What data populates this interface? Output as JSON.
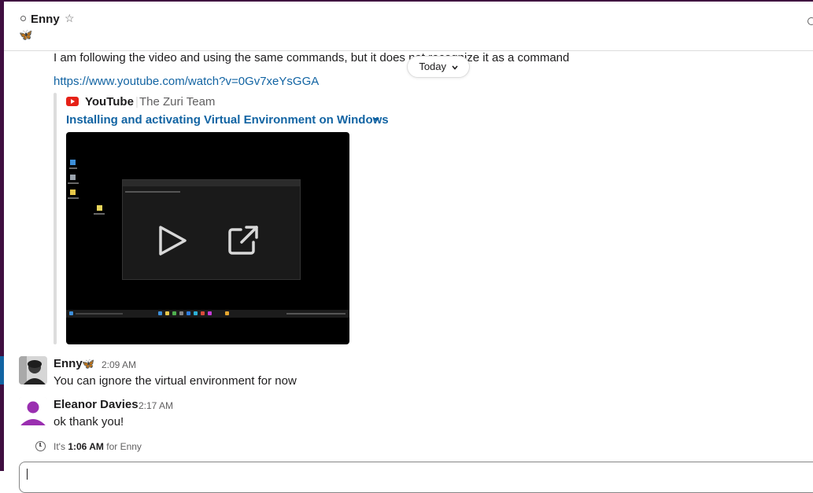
{
  "header": {
    "channel_name": "Enny",
    "status_emoji": "🦋",
    "star_icon": "☆"
  },
  "floating": {
    "today_label": "Today"
  },
  "message1": {
    "text": "I am following the video and using the same commands, but it does not recognize it as a command",
    "link": "https://www.youtube.com/watch?v=0Gv7xeYsGGA",
    "unfurl": {
      "service": "YouTube",
      "author": "The Zuri Team",
      "title": "Installing and activating Virtual Environment on Windows"
    }
  },
  "messages": [
    {
      "author": "Enny",
      "emoji": "🦋",
      "time": "2:09 AM",
      "text": "You can ignore the virtual environment for now"
    },
    {
      "author": "Eleanor Davies",
      "emoji": "",
      "time": "2:17 AM",
      "text": "ok thank you!"
    }
  ],
  "local_time": {
    "prefix": "It's",
    "time": "1:06 AM",
    "suffix": "for Enny"
  },
  "colors": {
    "sidebar": "#3f0e40",
    "link": "#1264a3",
    "eleanor_avatar": "#9a2fb0"
  }
}
